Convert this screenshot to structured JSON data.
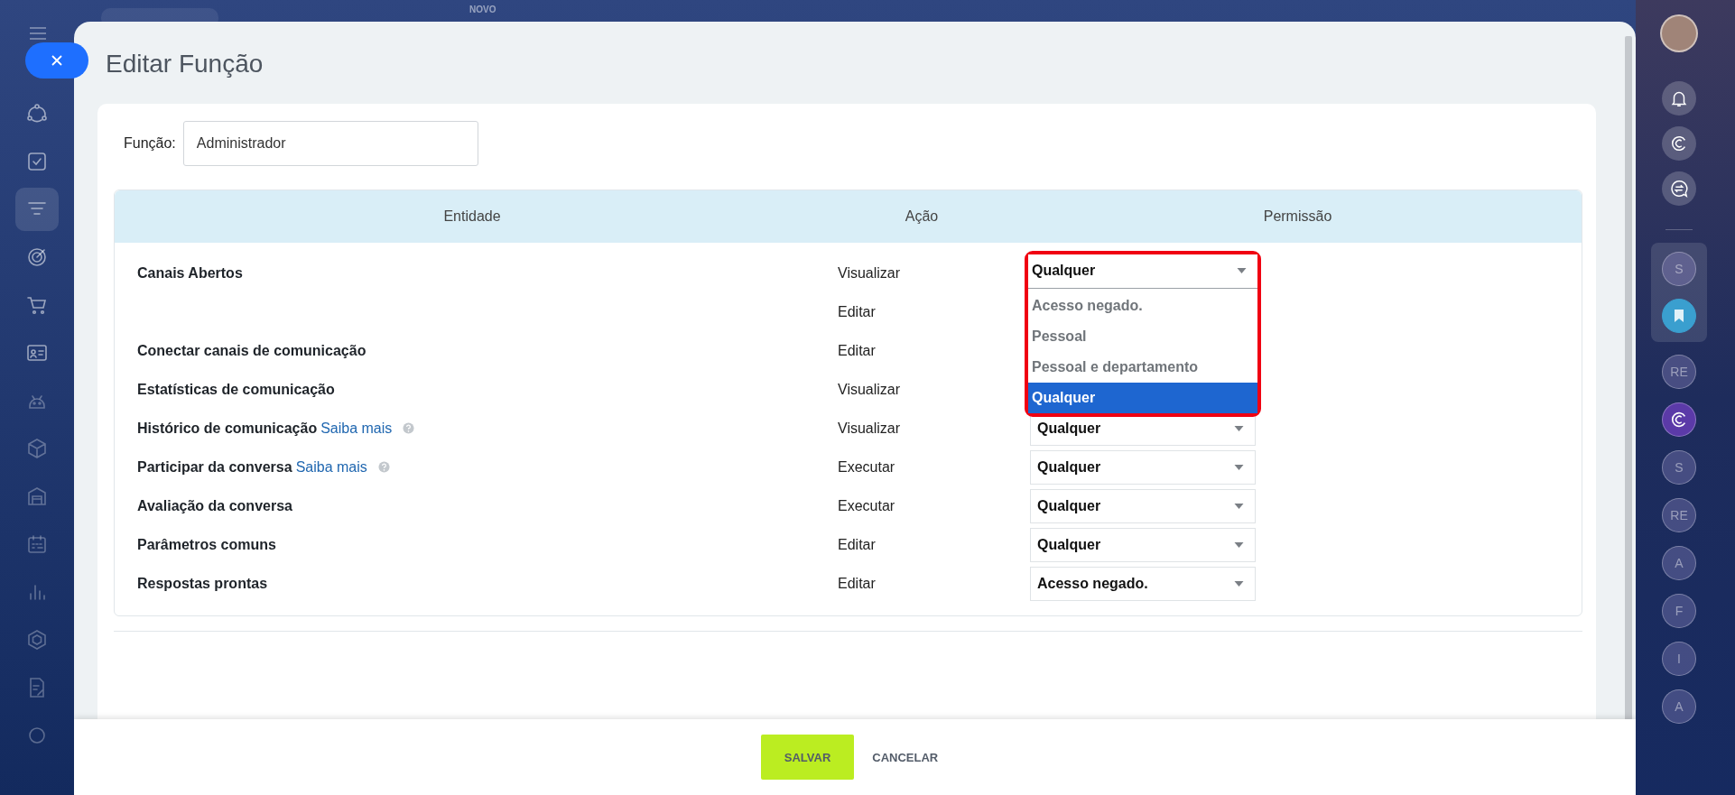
{
  "top_bar": {
    "label": "NOVO"
  },
  "left_sidebar": {
    "items": [
      {
        "kind": "sites",
        "selected": false
      },
      {
        "kind": "tasks",
        "selected": false
      },
      {
        "kind": "funnel",
        "selected": true
      },
      {
        "kind": "target",
        "selected": false
      },
      {
        "kind": "cart",
        "selected": false
      },
      {
        "kind": "contact",
        "selected": false
      },
      {
        "kind": "robot",
        "selected": false
      },
      {
        "kind": "box",
        "selected": false
      },
      {
        "kind": "garage",
        "selected": false
      },
      {
        "kind": "calendar",
        "selected": false
      },
      {
        "kind": "chart",
        "selected": false
      },
      {
        "kind": "hexagon",
        "selected": false
      },
      {
        "kind": "document",
        "selected": false
      },
      {
        "kind": "circle",
        "selected": false
      }
    ]
  },
  "dialog": {
    "title": "Editar Função",
    "role_field": {
      "label": "Função:",
      "value": "Administrador"
    },
    "table": {
      "columns": [
        "Entidade",
        "Ação",
        "Permissão"
      ],
      "rows": [
        {
          "entity": "Canais Abertos",
          "action": "Visualizar",
          "permission": {
            "value": "Qualquer",
            "open": true,
            "highlight": true,
            "options": [
              {
                "label": "Acesso negado.",
                "selected": false
              },
              {
                "label": "Pessoal",
                "selected": false
              },
              {
                "label": "Pessoal e departamento",
                "selected": false
              },
              {
                "label": "Qualquer",
                "selected": true
              }
            ]
          }
        },
        {
          "entity": "",
          "action": "Editar"
        },
        {
          "entity": "Conectar canais de comunicação",
          "action": "Editar"
        },
        {
          "entity": "Estatísticas de comunicação",
          "action": "Visualizar"
        },
        {
          "entity": "Histórico de comunicação",
          "link": "Saiba mais",
          "help": true,
          "action": "Visualizar",
          "permission": {
            "value": "Qualquer",
            "open": false,
            "highlight": false
          }
        },
        {
          "entity": "Participar da conversa",
          "link": "Saiba mais",
          "help": true,
          "action": "Executar",
          "permission": {
            "value": "Qualquer",
            "open": false,
            "highlight": false
          }
        },
        {
          "entity": "Avaliação da conversa",
          "action": "Executar",
          "permission": {
            "value": "Qualquer",
            "open": false,
            "highlight": false
          }
        },
        {
          "entity": "Parâmetros comuns",
          "action": "Editar",
          "permission": {
            "value": "Qualquer",
            "open": false,
            "highlight": false
          }
        },
        {
          "entity": "Respostas prontas",
          "action": "Editar",
          "permission": {
            "value": "Acesso negado.",
            "open": false,
            "highlight": false
          }
        }
      ]
    },
    "buttons": [
      {
        "kind": "primary",
        "label": "SALVAR"
      },
      {
        "kind": "secondary",
        "label": "CANCELAR"
      }
    ]
  },
  "right_sidebar": {
    "top": [
      {
        "kind": "avatar"
      },
      {
        "kind": "bell"
      },
      {
        "kind": "copilot"
      },
      {
        "kind": "sync"
      }
    ],
    "pinned": [
      {
        "kind": "letter",
        "label": "S"
      },
      {
        "kind": "bookmark"
      }
    ],
    "apps": [
      {
        "kind": "letter",
        "label": "RE"
      },
      {
        "kind": "copilot"
      },
      {
        "kind": "letter",
        "label": "S"
      },
      {
        "kind": "letter",
        "label": "RE"
      },
      {
        "kind": "letter",
        "label": "A"
      },
      {
        "kind": "letter",
        "label": "F"
      },
      {
        "kind": "letter",
        "label": "I"
      },
      {
        "kind": "letter",
        "label": "A"
      }
    ]
  }
}
